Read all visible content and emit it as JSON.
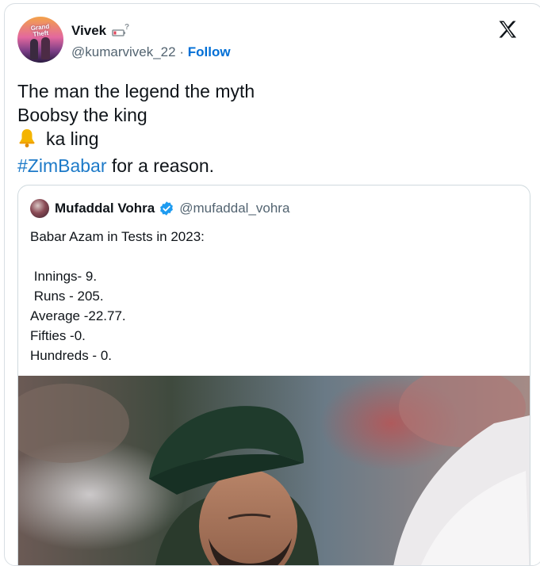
{
  "author": {
    "display_name": "Vivek",
    "handle": "@kumarvivek_22",
    "separator": "·",
    "follow_label": "Follow",
    "avatar_icon": "gta-poster-avatar",
    "name_emoji_icon": "battery-low-question-icon"
  },
  "brand": {
    "icon": "x-logo-icon",
    "color": "#0f1419"
  },
  "tweet": {
    "lines": [
      "The man the legend the myth",
      "Boobsy the king",
      "ka ling"
    ],
    "bell_icon": "bell-icon",
    "hashtag": "#ZimBabar",
    "hashtag_suffix": " for a reason."
  },
  "quoted_tweet": {
    "display_name": "Mufaddal Vohra",
    "verified_icon": "verified-badge-icon",
    "handle": "@mufaddal_vohra",
    "lines": [
      "Babar Azam in Tests in 2023:",
      "",
      " Innings- 9.",
      " Runs - 205.",
      "Average -22.77.",
      "Fifties -0.",
      "Hundreds - 0."
    ],
    "media_alt": "cricket-player-looking-up-photo"
  },
  "colors": {
    "link": "#1d7ac8",
    "follow": "#006fd6",
    "verified": "#1d9bf0",
    "text": "#0f1419",
    "muted": "#536471",
    "border": "#cfd9de",
    "bell": "#f4b400"
  }
}
